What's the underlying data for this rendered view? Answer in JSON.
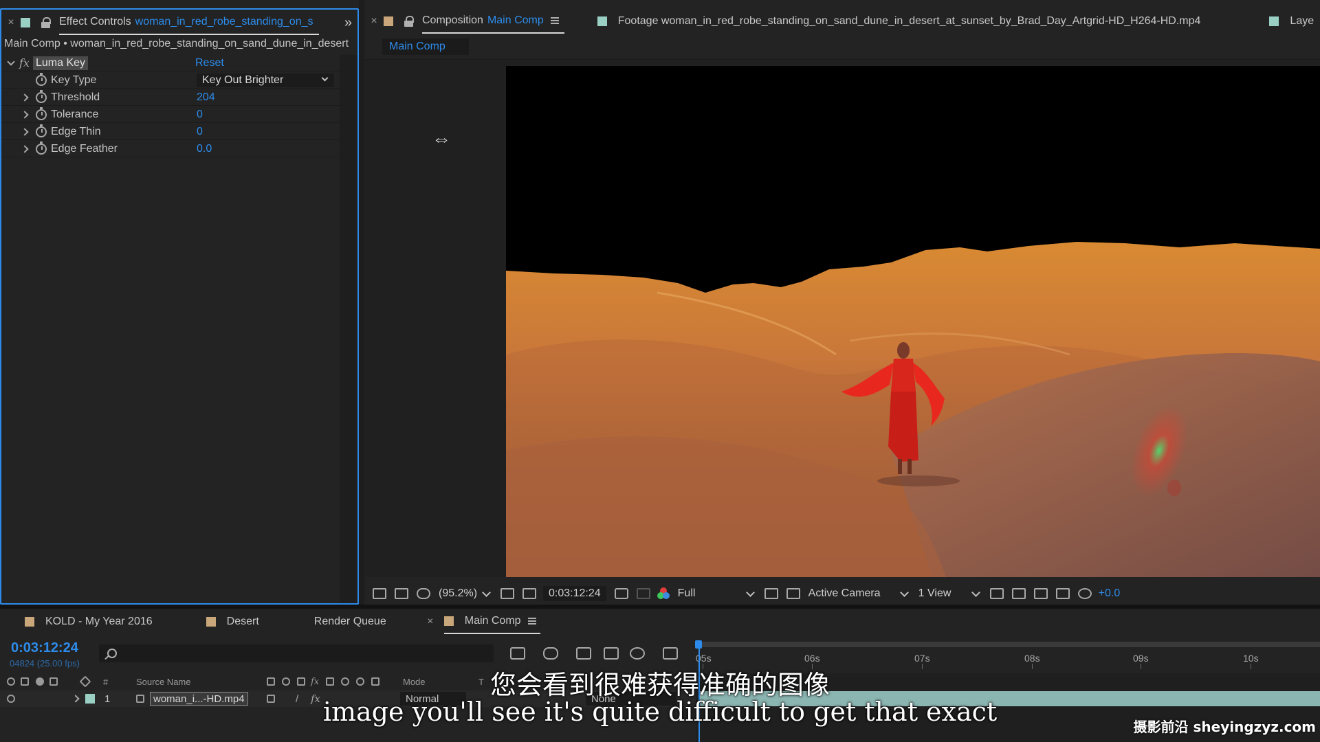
{
  "effect_controls": {
    "tab_label": "Effect Controls",
    "tab_layer": "woman_in_red_robe_standing_on_s",
    "subtitle": "Main Comp • woman_in_red_robe_standing_on_sand_dune_in_desert",
    "effect": {
      "fx": "fx",
      "name": "Luma Key",
      "reset_label": "Reset",
      "properties": [
        {
          "label": "Key Type",
          "value": "Key Out Brighter",
          "kind": "select"
        },
        {
          "label": "Threshold",
          "value": "204"
        },
        {
          "label": "Tolerance",
          "value": "0"
        },
        {
          "label": "Edge Thin",
          "value": "0"
        },
        {
          "label": "Edge Feather",
          "value": "0.0"
        }
      ]
    }
  },
  "composition": {
    "tab_prefix": "Composition",
    "tab_name": "Main Comp",
    "footage_tab": "Footage woman_in_red_robe_standing_on_sand_dune_in_desert_at_sunset_by_Brad_Day_Artgrid-HD_H264-HD.mp4",
    "layer_tab": "Laye",
    "breadcrumb": "Main Comp",
    "cursor_glyph": "⇔"
  },
  "viewer_toolbar": {
    "zoom": "(95.2%)",
    "timecode": "0:03:12:24",
    "resolution": "Full",
    "camera": "Active Camera",
    "views": "1 View",
    "exposure": "+0.0"
  },
  "timeline": {
    "tabs": [
      "KOLD - My Year 2016",
      "Desert",
      "Render Queue"
    ],
    "active_tab": "Main Comp",
    "close_glyph": "×",
    "timecode": "0:03:12:24",
    "fps": "04824 (25.00 fps)",
    "headers": {
      "number": "#",
      "source_name": "Source Name",
      "mode": "Mode",
      "t": "T"
    },
    "layer": {
      "number": "1",
      "name": "woman_i...-HD.mp4",
      "mode": "Normal",
      "trkmat": "None"
    },
    "ruler_labels": [
      "05s",
      "06s",
      "07s",
      "08s",
      "09s",
      "10s"
    ]
  },
  "overlay": {
    "subtitle_zh": "您会看到很难获得准确的图像",
    "subtitle_en": "image you'll see it's quite difficult to get that exact",
    "watermark": "摄影前沿 sheyingzyz.com"
  },
  "colors": {
    "accent_blue": "#2d8ceb",
    "panel_bg": "#232323",
    "layer_bar": "#8bb5b1",
    "label_green": "#9ad0c4",
    "label_tan": "#c9a77a"
  },
  "icons": [
    "close-icon",
    "lock-icon",
    "panel-menu-icon",
    "stopwatch-icon",
    "twirl-icon",
    "search-icon",
    "eye-icon",
    "audio-icon",
    "solo-icon",
    "camera-icon",
    "color-channels-icon",
    "resize-cursor-icon"
  ]
}
